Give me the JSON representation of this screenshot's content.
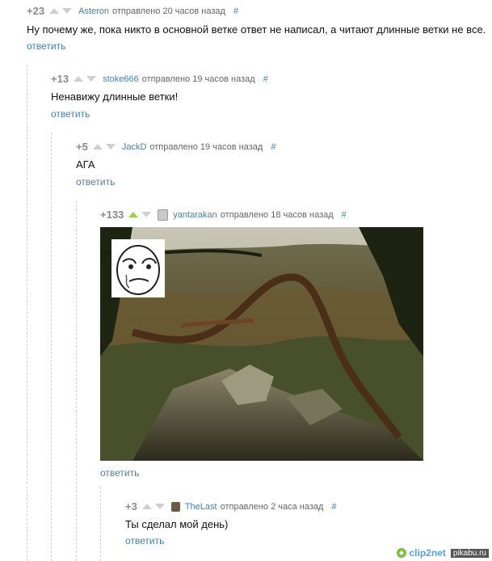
{
  "comments": [
    {
      "score": "+23",
      "user": "Asteron",
      "sent": "отправлено",
      "time": "20 часов назад",
      "hash": "#",
      "text": "Ну почему же, пока никто в основной ветке ответ не написал, а читают длинные ветки не все.",
      "reply": "ответить"
    },
    {
      "score": "+13",
      "user": "stoke666",
      "sent": "отправлено",
      "time": "19 часов назад",
      "hash": "#",
      "text": "Ненавижу длинные ветки!",
      "reply": "ответить"
    },
    {
      "score": "+5",
      "user": "JackD",
      "sent": "отправлено",
      "time": "19 часов назад",
      "hash": "#",
      "text": "АГА",
      "reply": "ответить"
    },
    {
      "score": "+133",
      "user": "yantarakan",
      "sent": "отправлено",
      "time": "18 часов назад",
      "hash": "#",
      "text": "",
      "reply": "ответить",
      "image": "forest-cliff-photo-with-okay-face-meme"
    },
    {
      "score": "+3",
      "user": "TheLast",
      "sent": "отправлено",
      "time": "2 часа назад",
      "hash": "#",
      "text": "Ты сделал мой день)",
      "reply": "ответить"
    }
  ],
  "watermark": {
    "brand": "clip2net",
    "site": "pikabu.ru"
  },
  "colors": {
    "link": "#4a7fb0",
    "arrow": "#cfcfcf",
    "arrow_active": "#9bd04c",
    "score": "#8a8a8a"
  }
}
